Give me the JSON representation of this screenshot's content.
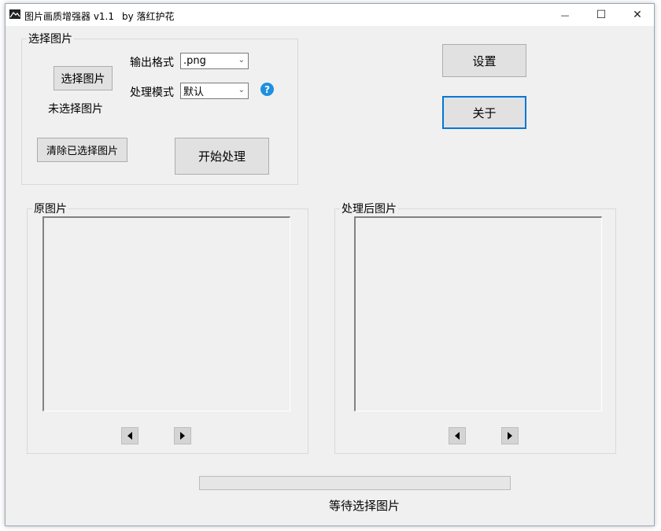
{
  "window": {
    "title": "图片画质增强器 v1.1",
    "author": "by 落红护花"
  },
  "titlebar_buttons": {
    "minimize": "—",
    "maximize": "☐",
    "close": "✕"
  },
  "select_group": {
    "legend": "选择图片",
    "select_button": "选择图片",
    "status": "未选择图片",
    "clear_button": "清除已选择图片",
    "output_format_label": "输出格式",
    "output_format_value": ".png",
    "mode_label": "处理模式",
    "mode_value": "默认",
    "help_glyph": "?",
    "start_button": "开始处理"
  },
  "actions": {
    "settings_button": "设置",
    "about_button": "关于"
  },
  "original_panel": {
    "legend": "原图片"
  },
  "processed_panel": {
    "legend": "处理后图片"
  },
  "progress": {
    "value": 0
  },
  "status_text": "等待选择图片",
  "colors": {
    "accent": "#0078d7",
    "help": "#1e90e0",
    "window_bg": "#f0f0f0"
  }
}
